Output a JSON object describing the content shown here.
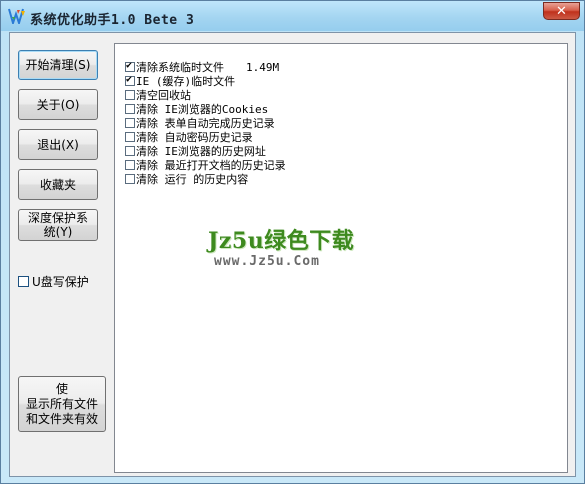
{
  "window": {
    "title": "系统优化助手1.0 Bete 3",
    "close_glyph": "✕"
  },
  "buttons": {
    "start": "开始清理(S)",
    "about": "关于(O)",
    "exit": "退出(X)",
    "favorites": "收藏夹",
    "deep_protect": "深度保护系\n统(Y)",
    "show_all": "使\n显示所有文件\n和文件夹有效"
  },
  "usb_protect": {
    "label": "U盘写保护",
    "checked": false
  },
  "options": [
    {
      "label": "清除系统临时文件",
      "checked": true,
      "size": "1.49M"
    },
    {
      "label": "IE (缓存)临时文件",
      "checked": true
    },
    {
      "label": "清空回收站",
      "checked": false
    },
    {
      "label": "清除 IE浏览器的Cookies",
      "checked": false
    },
    {
      "label": "清除 表单自动完成历史记录",
      "checked": false
    },
    {
      "label": "清除 自动密码历史记录",
      "checked": false
    },
    {
      "label": "清除 IE浏览器的历史网址",
      "checked": false
    },
    {
      "label": "清除 最近打开文档的历史记录",
      "checked": false
    },
    {
      "label": "清除 运行 的历史内容",
      "checked": false
    }
  ],
  "watermark": {
    "logo": "Jz5u绿色下载",
    "url": "www.Jz5u.Com"
  }
}
